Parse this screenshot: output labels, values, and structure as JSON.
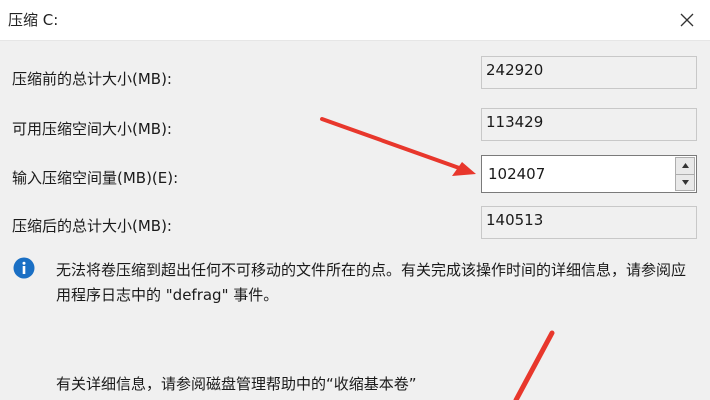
{
  "window": {
    "title": "压缩 C:",
    "close_icon": "close-icon"
  },
  "fields": {
    "total_before": {
      "label": "压缩前的总计大小(MB):",
      "value": "242920"
    },
    "available": {
      "label": "可用压缩空间大小(MB):",
      "value": "113429"
    },
    "shrink_amount": {
      "label": "输入压缩空间量(MB)(E):",
      "value": "102407"
    },
    "total_after": {
      "label": "压缩后的总计大小(MB):",
      "value": "140513"
    }
  },
  "info": {
    "icon": "info-icon",
    "text": "无法将卷压缩到超出任何不可移动的文件所在的点。有关完成该操作时间的详细信息，请参阅应用程序日志中的 \"defrag\" 事件。",
    "more": "有关详细信息，请参阅磁盘管理帮助中的“收缩基本卷”"
  },
  "colors": {
    "annotation_arrow": "#e8372c",
    "info_icon": "#1a6fc4",
    "dialog_bg": "#f0f0f0"
  }
}
